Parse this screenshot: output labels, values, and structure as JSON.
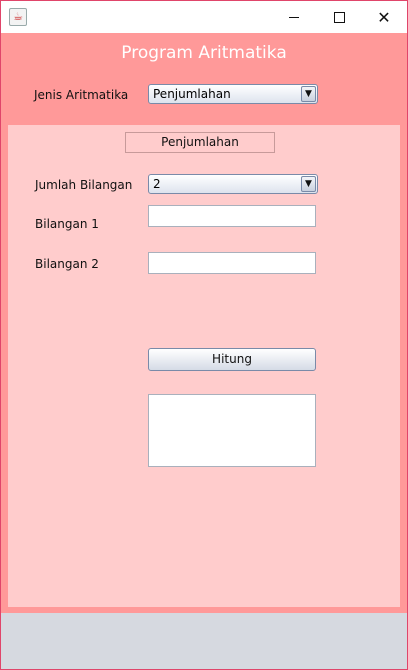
{
  "window": {
    "controls": {
      "minimize_icon": "minimize-icon",
      "maximize_icon": "maximize-icon",
      "close_icon": "close-icon"
    }
  },
  "app": {
    "title": "Program Aritmatika"
  },
  "header": {
    "jenis_label": "Jenis Aritmatika",
    "jenis_value": "Penjumlahan"
  },
  "panel": {
    "subtitle": "Penjumlahan",
    "jumlah_label": "Jumlah Bilangan",
    "jumlah_value": "2",
    "bilangan1_label": "Bilangan 1",
    "bilangan1_value": "",
    "bilangan2_label": "Bilangan 2",
    "bilangan2_value": "",
    "hitung_label": "Hitung",
    "result_value": ""
  },
  "colors": {
    "content_bg": "#ff9999",
    "panel_bg": "#ffcccc",
    "title_text": "#ffffff"
  }
}
